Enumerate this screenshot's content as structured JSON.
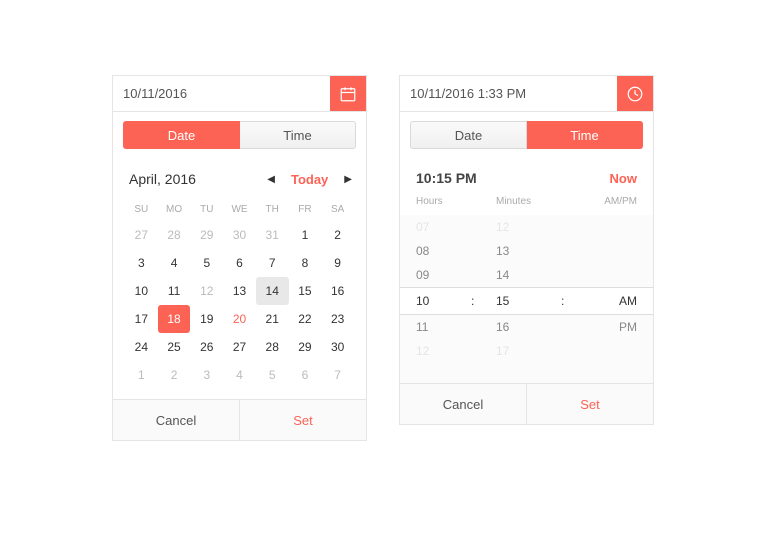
{
  "datePicker": {
    "inputValue": "10/11/2016",
    "tabs": {
      "date": "Date",
      "time": "Time"
    },
    "monthLabel": "April, 2016",
    "todayLabel": "Today",
    "dow": [
      "SU",
      "MO",
      "TU",
      "WE",
      "TH",
      "FR",
      "SA"
    ],
    "days": [
      {
        "n": "27",
        "out": true
      },
      {
        "n": "28",
        "out": true
      },
      {
        "n": "29",
        "out": true
      },
      {
        "n": "30",
        "out": true
      },
      {
        "n": "31",
        "out": true
      },
      {
        "n": "1"
      },
      {
        "n": "2"
      },
      {
        "n": "3"
      },
      {
        "n": "4"
      },
      {
        "n": "5"
      },
      {
        "n": "6"
      },
      {
        "n": "7"
      },
      {
        "n": "8"
      },
      {
        "n": "9"
      },
      {
        "n": "10"
      },
      {
        "n": "11"
      },
      {
        "n": "12",
        "out": true
      },
      {
        "n": "13"
      },
      {
        "n": "14",
        "hov": true
      },
      {
        "n": "15"
      },
      {
        "n": "16"
      },
      {
        "n": "17"
      },
      {
        "n": "18",
        "sel": true
      },
      {
        "n": "19"
      },
      {
        "n": "20",
        "today": true
      },
      {
        "n": "21"
      },
      {
        "n": "22"
      },
      {
        "n": "23"
      },
      {
        "n": "24"
      },
      {
        "n": "25"
      },
      {
        "n": "26"
      },
      {
        "n": "27"
      },
      {
        "n": "28"
      },
      {
        "n": "29"
      },
      {
        "n": "30"
      },
      {
        "n": "1",
        "out": true
      },
      {
        "n": "2",
        "out": true
      },
      {
        "n": "3",
        "out": true
      },
      {
        "n": "4",
        "out": true
      },
      {
        "n": "5",
        "out": true
      },
      {
        "n": "6",
        "out": true
      },
      {
        "n": "7",
        "out": true
      }
    ],
    "cancel": "Cancel",
    "set": "Set"
  },
  "timePicker": {
    "inputValue": "10/11/2016 1:33 PM",
    "tabs": {
      "date": "Date",
      "time": "Time"
    },
    "currentValue": "10:15 PM",
    "nowLabel": "Now",
    "cols": {
      "hours": "Hours",
      "minutes": "Minutes",
      "ampm": "AM/PM"
    },
    "rows": [
      {
        "h": "07",
        "m": "12",
        "ap": "",
        "cls": "fade-top"
      },
      {
        "h": "08",
        "m": "13",
        "ap": "",
        "cls": "near"
      },
      {
        "h": "09",
        "m": "14",
        "ap": "",
        "cls": "near"
      },
      {
        "h": "10",
        "m": "15",
        "ap": "AM",
        "cls": "sel"
      },
      {
        "h": "11",
        "m": "16",
        "ap": "PM",
        "cls": "near"
      },
      {
        "h": "12",
        "m": "17",
        "ap": "",
        "cls": "fade-bot"
      }
    ],
    "cancel": "Cancel",
    "set": "Set"
  }
}
